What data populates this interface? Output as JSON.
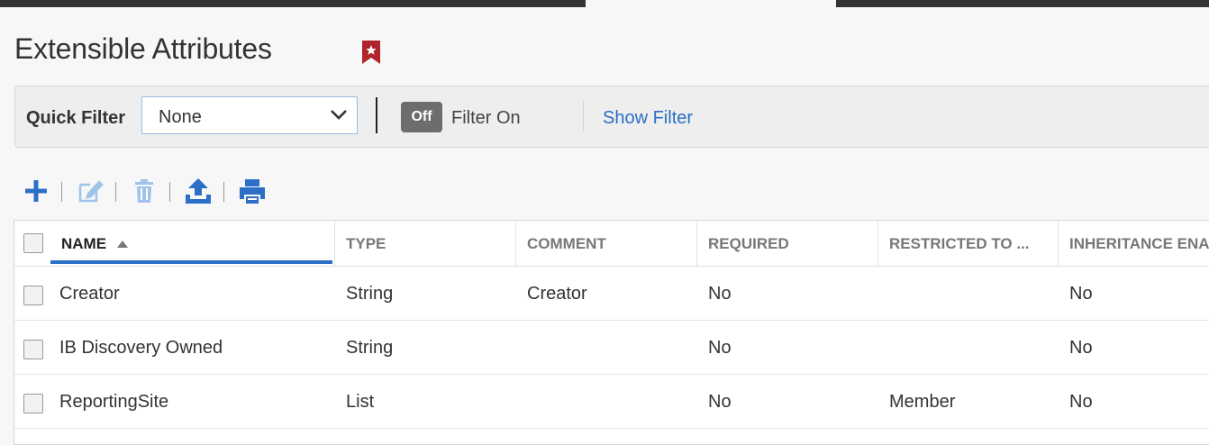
{
  "page": {
    "title": "Extensible Attributes"
  },
  "quick_filter": {
    "label": "Quick Filter",
    "selected": "None",
    "toggle_label": "Off",
    "filter_on_label": "Filter On",
    "show_filter_link": "Show Filter"
  },
  "toolbar": {
    "buttons": [
      {
        "name": "add-button",
        "icon": "plus-icon"
      },
      {
        "name": "edit-button",
        "icon": "edit-icon",
        "disabled": true
      },
      {
        "name": "delete-button",
        "icon": "trash-icon",
        "disabled": true
      },
      {
        "name": "export-button",
        "icon": "upload-icon"
      },
      {
        "name": "print-button",
        "icon": "print-icon"
      }
    ]
  },
  "table": {
    "columns": [
      "NAME",
      "TYPE",
      "COMMENT",
      "REQUIRED",
      "RESTRICTED TO ...",
      "INHERITANCE ENA"
    ],
    "sort": {
      "column": "NAME",
      "direction": "ascending"
    },
    "rows": [
      {
        "name": "Creator",
        "type": "String",
        "comment": "Creator",
        "required": "No",
        "restricted": "",
        "inheritance": "No"
      },
      {
        "name": "IB Discovery Owned",
        "type": "String",
        "comment": "",
        "required": "No",
        "restricted": "",
        "inheritance": "No"
      },
      {
        "name": "ReportingSite",
        "type": "List",
        "comment": "",
        "required": "No",
        "restricted": "Member",
        "inheritance": "No"
      }
    ]
  },
  "colors": {
    "accent": "#2b6fc7",
    "bookmark": "#b0232a",
    "icon_disabled": "#9fc3ea"
  }
}
